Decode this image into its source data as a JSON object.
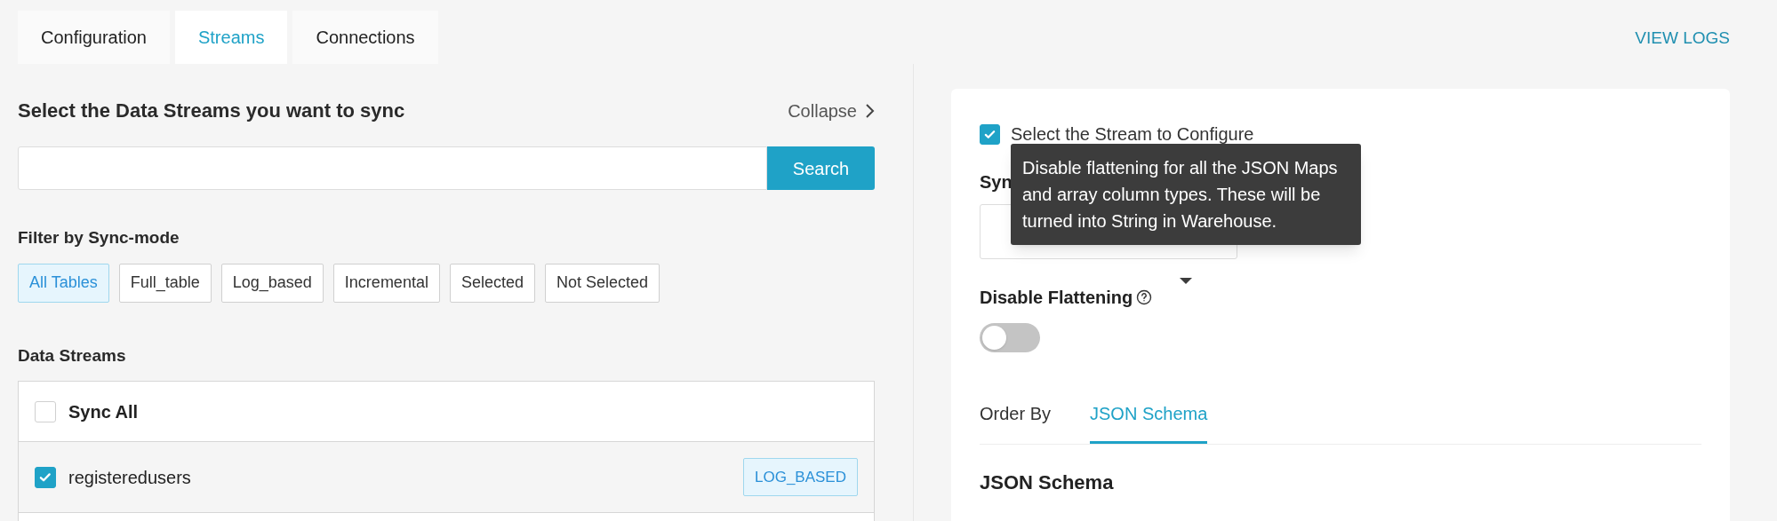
{
  "top_tabs": [
    {
      "label": "Configuration",
      "selected": false
    },
    {
      "label": "Streams",
      "selected": true
    },
    {
      "label": "Connections",
      "selected": false
    }
  ],
  "view_logs": "VIEW LOGS",
  "streams_panel": {
    "title": "Select the Data Streams you want to sync",
    "collapse": "Collapse",
    "search_button": "Search",
    "filter_label": "Filter by Sync-mode",
    "filters": [
      {
        "label": "All Tables",
        "selected": true
      },
      {
        "label": "Full_table",
        "selected": false
      },
      {
        "label": "Log_based",
        "selected": false
      },
      {
        "label": "Incremental",
        "selected": false
      },
      {
        "label": "Selected",
        "selected": false
      },
      {
        "label": "Not Selected",
        "selected": false
      }
    ],
    "list_title": "Data Streams",
    "sync_all": {
      "label": "Sync All",
      "checked": false
    },
    "streams": [
      {
        "name": "registeredusers",
        "checked": true,
        "badge": "LOG_BASED"
      }
    ]
  },
  "config_panel": {
    "select_stream": {
      "label": "Select the Stream to Configure",
      "checked": true
    },
    "sync_mode": {
      "label": "Syn"
    },
    "disable_flattening": {
      "label": "Disable Flattening",
      "on": false
    },
    "tooltip": "Disable flattening for all the JSON Maps and array column types. These will be turned into String in Warehouse.",
    "tabs": [
      {
        "label": "Order By",
        "selected": false
      },
      {
        "label": "JSON Schema",
        "selected": true
      }
    ],
    "section_title": "JSON Schema"
  }
}
